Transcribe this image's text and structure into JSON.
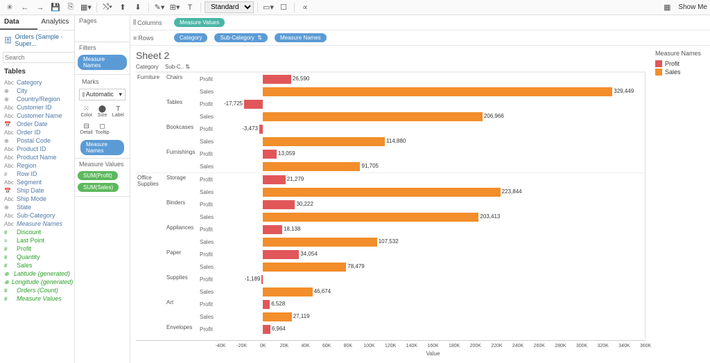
{
  "toolbar": {
    "view_mode": "Standard",
    "show_me": "Show Me"
  },
  "data_panel": {
    "tab_data": "Data",
    "tab_analytics": "Analytics",
    "datasource": "Orders (Sample - Super...",
    "search_placeholder": "Search",
    "tables_header": "Tables",
    "fields": [
      {
        "name": "Category",
        "ico": "Abc",
        "kind": "dim"
      },
      {
        "name": "City",
        "ico": "⊕",
        "kind": "dim"
      },
      {
        "name": "Country/Region",
        "ico": "⊕",
        "kind": "dim"
      },
      {
        "name": "Customer ID",
        "ico": "Abc",
        "kind": "dim"
      },
      {
        "name": "Customer Name",
        "ico": "Abc",
        "kind": "dim"
      },
      {
        "name": "Order Date",
        "ico": "📅",
        "kind": "dim"
      },
      {
        "name": "Order ID",
        "ico": "Abc",
        "kind": "dim"
      },
      {
        "name": "Postal Code",
        "ico": "⊕",
        "kind": "dim"
      },
      {
        "name": "Product ID",
        "ico": "Abc",
        "kind": "dim"
      },
      {
        "name": "Product Name",
        "ico": "Abc",
        "kind": "dim"
      },
      {
        "name": "Region",
        "ico": "Abc",
        "kind": "dim"
      },
      {
        "name": "Row ID",
        "ico": "#",
        "kind": "dim"
      },
      {
        "name": "Segment",
        "ico": "Abc",
        "kind": "dim"
      },
      {
        "name": "Ship Date",
        "ico": "📅",
        "kind": "dim"
      },
      {
        "name": "Ship Mode",
        "ico": "Abc",
        "kind": "dim"
      },
      {
        "name": "State",
        "ico": "⊕",
        "kind": "dim"
      },
      {
        "name": "Sub-Category",
        "ico": "Abc",
        "kind": "dim"
      },
      {
        "name": "Measure Names",
        "ico": "Abc",
        "kind": "dim italic"
      },
      {
        "name": "Discount",
        "ico": "#",
        "kind": "meas"
      },
      {
        "name": "Last Point",
        "ico": "=",
        "kind": "meas"
      },
      {
        "name": "Profit",
        "ico": "#",
        "kind": "meas"
      },
      {
        "name": "Quantity",
        "ico": "#",
        "kind": "meas"
      },
      {
        "name": "Sales",
        "ico": "#",
        "kind": "meas"
      },
      {
        "name": "Latitude (generated)",
        "ico": "⊕",
        "kind": "meas italic"
      },
      {
        "name": "Longitude (generated)",
        "ico": "⊕",
        "kind": "meas italic"
      },
      {
        "name": "Orders (Count)",
        "ico": "#",
        "kind": "meas italic"
      },
      {
        "name": "Measure Values",
        "ico": "#",
        "kind": "meas italic"
      }
    ]
  },
  "cards": {
    "pages": "Pages",
    "filters": "Filters",
    "filter_pill": "Measure Names",
    "marks": "Marks",
    "marks_type": "Automatic",
    "marks_cells": [
      "Color",
      "Size",
      "Label",
      "Detail",
      "Tooltip",
      ""
    ],
    "marks_pill": "Measure Names",
    "measure_values": "Measure Values",
    "mv_pills": [
      "SUM(Profit)",
      "SUM(Sales)"
    ]
  },
  "shelves": {
    "columns_label": "Columns",
    "columns_pill": "Measure Values",
    "rows_label": "Rows",
    "rows_pills": [
      "Category",
      "Sub-Category",
      "Measure Names"
    ]
  },
  "viz": {
    "sheet_title": "Sheet 2",
    "hdr_category": "Category",
    "hdr_sub": "Sub-C.. ",
    "axis_label": "Value",
    "axis_ticks": [
      "-40K",
      "-20K",
      "0K",
      "20K",
      "40K",
      "60K",
      "80K",
      "100K",
      "120K",
      "140K",
      "160K",
      "180K",
      "200K",
      "220K",
      "240K",
      "260K",
      "280K",
      "300K",
      "320K",
      "340K",
      "360K"
    ],
    "legend_title": "Measure Names",
    "legend_items": [
      "Profit",
      "Sales"
    ],
    "colors": {
      "Profit": "#e15759",
      "Sales": "#f28e2b"
    }
  },
  "chart_data": {
    "type": "bar",
    "orientation": "horizontal",
    "xlabel": "Value",
    "xlim": [
      -40000,
      360000
    ],
    "series_names": [
      "Profit",
      "Sales"
    ],
    "colors": {
      "Profit": "#e15759",
      "Sales": "#f28e2b"
    },
    "groups": [
      {
        "category": "Furniture",
        "subs": [
          {
            "sub": "Chairs",
            "Profit": 26590,
            "Sales": 329449
          },
          {
            "sub": "Tables",
            "Profit": -17725,
            "Sales": 206966
          },
          {
            "sub": "Bookcases",
            "Profit": -3473,
            "Sales": 114880
          },
          {
            "sub": "Furnishings",
            "Profit": 13059,
            "Sales": 91705
          }
        ]
      },
      {
        "category": "Office Supplies",
        "subs": [
          {
            "sub": "Storage",
            "Profit": 21279,
            "Sales": 223844
          },
          {
            "sub": "Binders",
            "Profit": 30222,
            "Sales": 203413
          },
          {
            "sub": "Appliances",
            "Profit": 18138,
            "Sales": 107532
          },
          {
            "sub": "Paper",
            "Profit": 34054,
            "Sales": 78479
          },
          {
            "sub": "Supplies",
            "Profit": -1189,
            "Sales": 46674
          },
          {
            "sub": "Art",
            "Profit": 6528,
            "Sales": 27119
          },
          {
            "sub": "Envelopes",
            "Profit": 6964,
            "Sales": null
          }
        ]
      }
    ]
  }
}
